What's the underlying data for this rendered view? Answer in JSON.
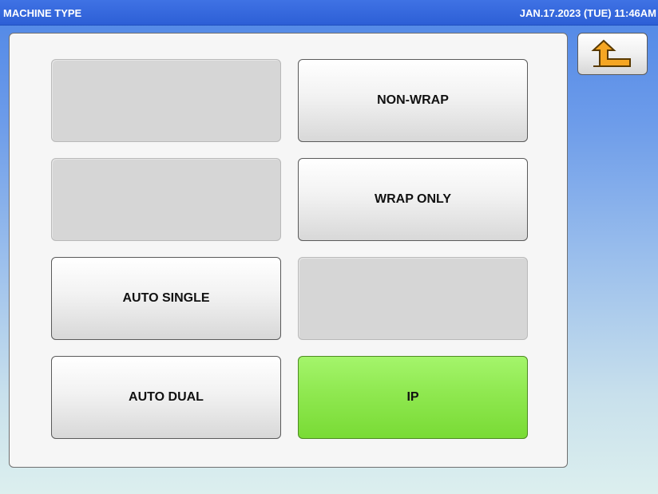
{
  "header": {
    "title": "MACHINE TYPE",
    "datetime": "JAN.17.2023 (TUE)  11:46AM"
  },
  "buttons": {
    "empty_1": "",
    "non_wrap": "NON-WRAP",
    "empty_2": "",
    "wrap_only": "WRAP ONLY",
    "auto_single": "AUTO SINGLE",
    "empty_3": "",
    "auto_dual": "AUTO DUAL",
    "ip": "IP"
  },
  "selected_option": "IP",
  "back_button": {
    "icon": "return-arrow-icon"
  },
  "colors": {
    "title_bar": "#2d5fd6",
    "selected_button": "#8fe850",
    "disabled_button": "#d6d6d6",
    "background_top": "#4f86e6",
    "background_bottom": "#dcefee"
  }
}
